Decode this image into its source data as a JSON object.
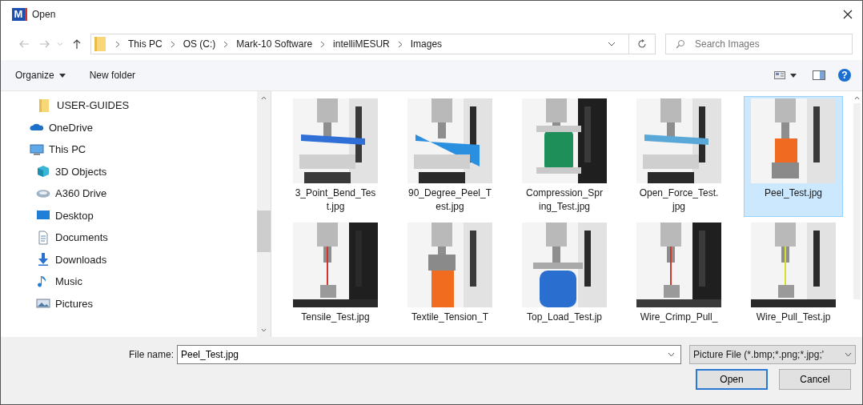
{
  "window": {
    "title": "Open",
    "app_icon_letter": "M"
  },
  "address_bar": {
    "path": [
      "This PC",
      "OS (C:)",
      "Mark-10 Software",
      "intelliMESUR",
      "Images"
    ]
  },
  "search": {
    "placeholder": "Search Images"
  },
  "toolbar": {
    "organize": "Organize",
    "new_folder": "New folder",
    "help": "?"
  },
  "nav": [
    {
      "children": [
        {
          "label": "USER-GUIDES",
          "kind": "folder"
        }
      ]
    },
    {
      "label": "OneDrive",
      "kind": "cloud"
    },
    {
      "label": "This PC",
      "kind": "pc",
      "children": [
        {
          "label": "3D Objects",
          "kind": "cube"
        },
        {
          "label": "A360 Drive",
          "kind": "drive"
        },
        {
          "label": "Desktop",
          "kind": "desktop"
        },
        {
          "label": "Documents",
          "kind": "document"
        },
        {
          "label": "Downloads",
          "kind": "download"
        },
        {
          "label": "Music",
          "kind": "music"
        },
        {
          "label": "Pictures",
          "kind": "pictures"
        }
      ]
    }
  ],
  "files": [
    {
      "lines": [
        "3_Point_Bend_Tes",
        "t.jpg"
      ],
      "selected": false,
      "kind": "picture"
    },
    {
      "lines": [
        "90_Degree_Peel_T",
        "est.jpg"
      ],
      "selected": false,
      "kind": "picture"
    },
    {
      "lines": [
        "Compression_Spr",
        "ing_Test.jpg"
      ],
      "selected": false,
      "kind": "picture"
    },
    {
      "lines": [
        "Open_Force_Test.",
        "jpg"
      ],
      "selected": false,
      "kind": "picture"
    },
    {
      "lines": [
        "Peel_Test.jpg"
      ],
      "selected": true,
      "kind": "picture"
    },
    {
      "lines": [
        "Tensile_Test.jpg"
      ],
      "selected": false,
      "kind": "picture"
    },
    {
      "lines": [
        "Textile_Tension_T"
      ],
      "selected": false,
      "kind": "picture"
    },
    {
      "lines": [
        "Top_Load_Test.jp"
      ],
      "selected": false,
      "kind": "picture"
    },
    {
      "lines": [
        "Wire_Crimp_Pull_"
      ],
      "selected": false,
      "kind": "picture"
    },
    {
      "lines": [
        "Wire_Pull_Test.jp"
      ],
      "selected": false,
      "kind": "picture"
    }
  ],
  "file_name": {
    "label": "File name:",
    "value": "Peel_Test.jpg"
  },
  "file_type": "Picture File (*.bmp;*.png;*.jpg;'",
  "buttons": [
    {
      "label": "Open",
      "default": true
    },
    {
      "label": "Cancel",
      "default": false
    }
  ]
}
